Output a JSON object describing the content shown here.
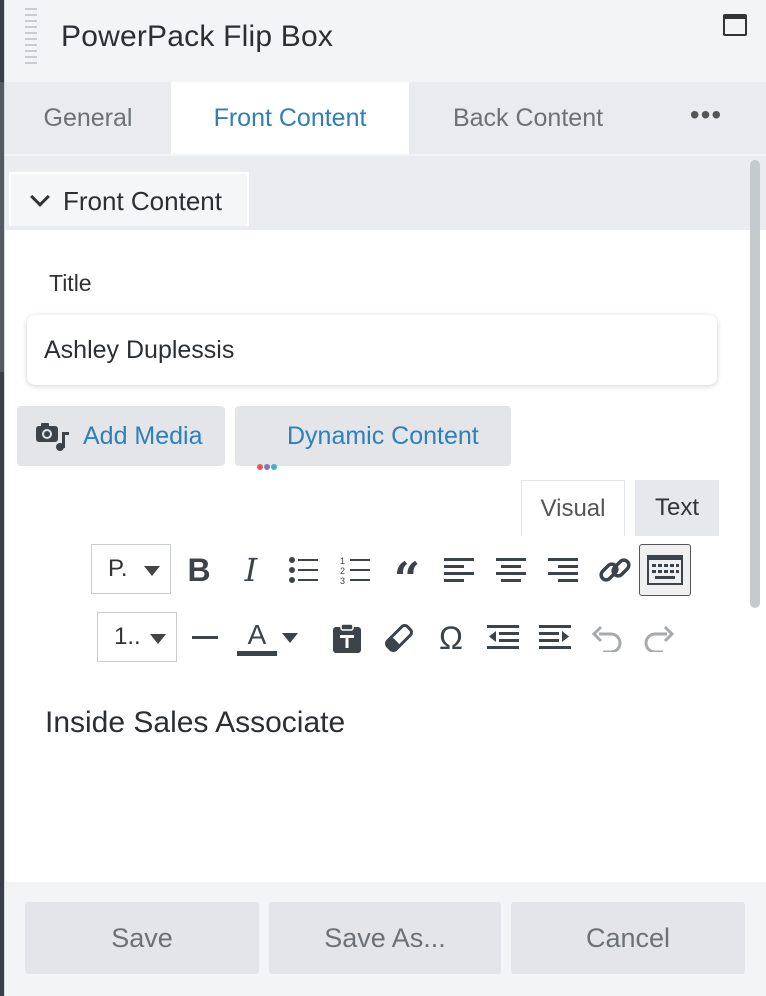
{
  "window": {
    "title": "PowerPack Flip Box"
  },
  "tabs": [
    {
      "label": "General",
      "active": false
    },
    {
      "label": "Front Content",
      "active": true
    },
    {
      "label": "Back Content",
      "active": false
    },
    {
      "label": "•••",
      "active": false
    }
  ],
  "section": {
    "label": "Front Content"
  },
  "title_field": {
    "label": "Title",
    "value": "Ashley Duplessis"
  },
  "media": {
    "add_media_label": "Add Media",
    "dynamic_content_label": "Dynamic Content"
  },
  "editor": {
    "tabs": {
      "visual": "Visual",
      "text": "Text"
    },
    "format_select": "P.",
    "size_select": "1..",
    "content": "Inside Sales Associate"
  },
  "footer": {
    "save": "Save",
    "save_as": "Save As...",
    "cancel": "Cancel"
  },
  "colors": {
    "accent": "#2f7fb8",
    "panel": "#f3f4f6",
    "button": "#e3e5e8"
  }
}
